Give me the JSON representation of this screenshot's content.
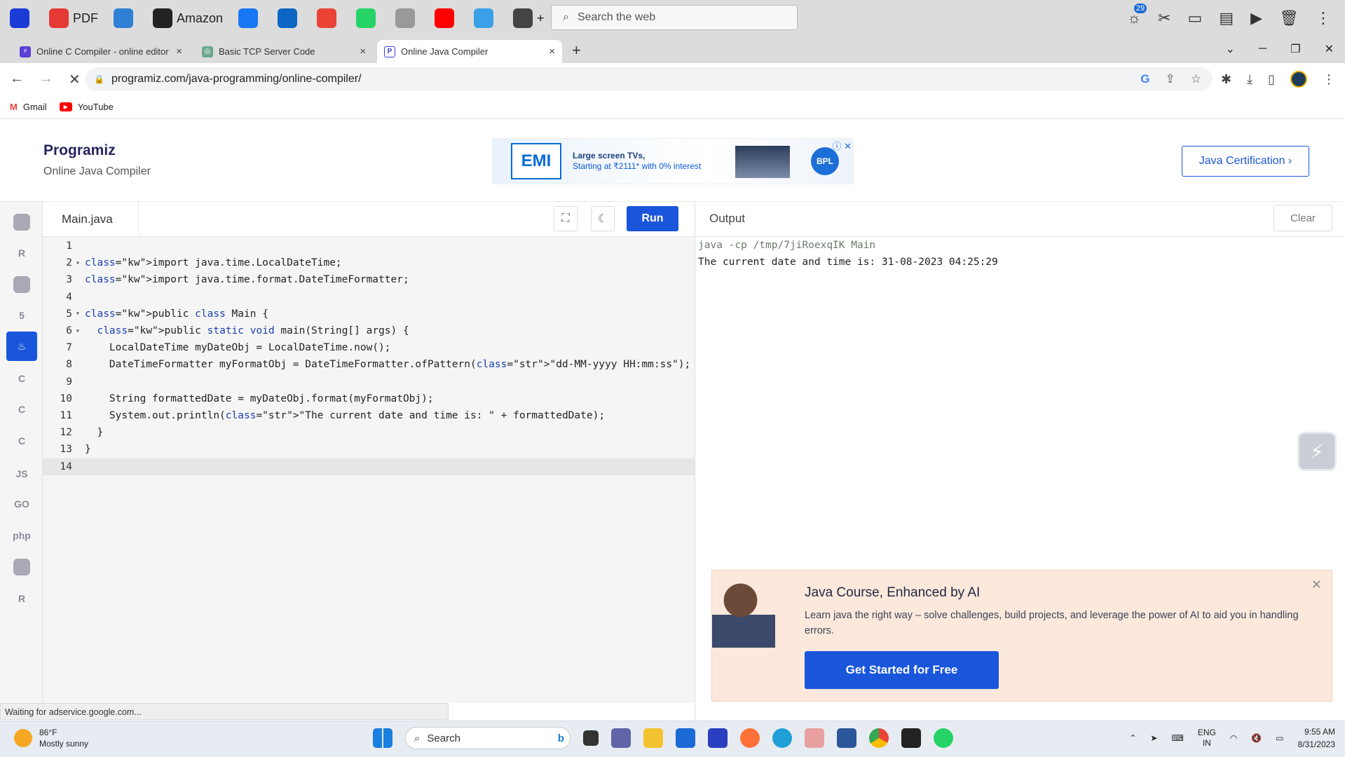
{
  "windows_topbar": {
    "items": [
      {
        "label": "",
        "icon": "app-circle-icon",
        "color": "#1b3bd6"
      },
      {
        "label": "PDF",
        "icon": "pdf-icon",
        "color": "#e53935"
      },
      {
        "label": "",
        "icon": "notes-icon",
        "color": "#2f7fd4"
      },
      {
        "label": "Amazon",
        "icon": "amazon-icon",
        "color": "#222222"
      },
      {
        "label": "",
        "icon": "facebook-icon",
        "color": "#1877f2"
      },
      {
        "label": "",
        "icon": "linkedin-icon",
        "color": "#0a66c2"
      },
      {
        "label": "",
        "icon": "gmail-icon",
        "color": "#ea4335"
      },
      {
        "label": "",
        "icon": "whatsapp-icon",
        "color": "#25d366"
      },
      {
        "label": "",
        "icon": "wikipedia-icon",
        "color": "#999999"
      },
      {
        "label": "",
        "icon": "youtube-icon",
        "color": "#ff0000"
      },
      {
        "label": "",
        "icon": "photos-icon",
        "color": "#3aa0e8"
      },
      {
        "label": "+",
        "icon": "add-icon",
        "color": "#444444"
      }
    ],
    "search_placeholder": "Search the web",
    "notification_count": "29"
  },
  "browser": {
    "tabs": [
      {
        "title": "Online C Compiler - online editor",
        "favicon_color": "#5b3fd6",
        "active": false
      },
      {
        "title": "Basic TCP Server Code",
        "favicon_color": "#6da88f",
        "active": false
      },
      {
        "title": "Online Java Compiler",
        "favicon_color": "#3b3fd6",
        "active": true
      }
    ],
    "new_tab": "+",
    "url": "programiz.com/java-programming/online-compiler/",
    "bookmarks": [
      {
        "label": "Gmail",
        "icon": "gmail-icon"
      },
      {
        "label": "YouTube",
        "icon": "youtube-icon"
      }
    ]
  },
  "site": {
    "logo": "Programiz",
    "subtitle": "Online Java Compiler",
    "ad": {
      "brand": "EMI",
      "line1": "Large screen TVs,",
      "line2": "Starting at ₹2111* with 0% interest",
      "badge": "BPL"
    },
    "cert_button": "Java Certification ›"
  },
  "languages": [
    {
      "name": "python",
      "label": "",
      "selected": false
    },
    {
      "name": "r",
      "label": "R",
      "selected": false
    },
    {
      "name": "sql",
      "label": "",
      "selected": false
    },
    {
      "name": "html",
      "label": "5",
      "selected": false
    },
    {
      "name": "java",
      "label": "♨",
      "selected": true
    },
    {
      "name": "c",
      "label": "C",
      "selected": false
    },
    {
      "name": "cpp",
      "label": "C",
      "selected": false
    },
    {
      "name": "csharp",
      "label": "C",
      "selected": false
    },
    {
      "name": "javascript",
      "label": "JS",
      "selected": false
    },
    {
      "name": "go",
      "label": "GO",
      "selected": false
    },
    {
      "name": "php",
      "label": "php",
      "selected": false
    },
    {
      "name": "swift",
      "label": "",
      "selected": false
    },
    {
      "name": "rust",
      "label": "R",
      "selected": false
    }
  ],
  "editor": {
    "filename": "Main.java",
    "run_label": "Run",
    "lines": [
      {
        "n": "1",
        "fold": "",
        "code": ""
      },
      {
        "n": "2",
        "fold": "▾",
        "code": "import java.time.LocalDateTime;"
      },
      {
        "n": "3",
        "fold": "",
        "code": "import java.time.format.DateTimeFormatter;"
      },
      {
        "n": "4",
        "fold": "",
        "code": ""
      },
      {
        "n": "5",
        "fold": "▾",
        "code": "public class Main {"
      },
      {
        "n": "6",
        "fold": "▾",
        "code": "  public static void main(String[] args) {"
      },
      {
        "n": "7",
        "fold": "",
        "code": "    LocalDateTime myDateObj = LocalDateTime.now();"
      },
      {
        "n": "8",
        "fold": "",
        "code": "    DateTimeFormatter myFormatObj = DateTimeFormatter.ofPattern(\"dd-MM-yyyy HH:mm:ss\");"
      },
      {
        "n": "9",
        "fold": "",
        "code": ""
      },
      {
        "n": "10",
        "fold": "",
        "code": "    String formattedDate = myDateObj.format(myFormatObj);"
      },
      {
        "n": "11",
        "fold": "",
        "code": "    System.out.println(\"The current date and time is: \" + formattedDate);"
      },
      {
        "n": "12",
        "fold": "",
        "code": "  }"
      },
      {
        "n": "13",
        "fold": "",
        "code": "}"
      },
      {
        "n": "14",
        "fold": "",
        "code": "",
        "active": true
      }
    ]
  },
  "output": {
    "title": "Output",
    "clear_label": "Clear",
    "lines": [
      "java -cp /tmp/7jiRoexqIK Main",
      "The current date and time is: 31-08-2023 04:25:29"
    ]
  },
  "promo": {
    "title": "Java Course, Enhanced by AI",
    "desc": "Learn java the right way – solve challenges, build projects, and leverage the power of AI to aid you in handling errors.",
    "button": "Get Started for Free"
  },
  "status_text": "Waiting for adservice.google.com...",
  "taskbar": {
    "temp": "86°F",
    "weather": "Mostly sunny",
    "search": "Search",
    "lang_line1": "ENG",
    "lang_line2": "IN",
    "time": "9:55 AM",
    "date": "8/31/2023"
  }
}
